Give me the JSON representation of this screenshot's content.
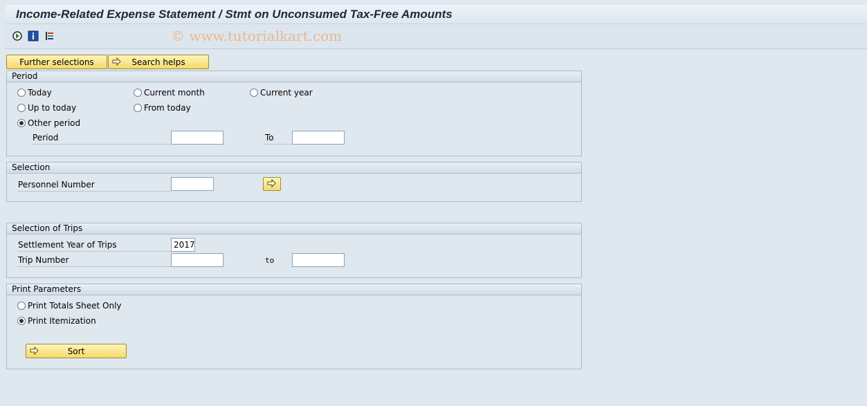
{
  "window": {
    "title": "Income-Related Expense Statement / Stmt on Unconsumed Tax-Free Amounts"
  },
  "toolbar": {
    "icons": [
      "execute-icon",
      "info-icon",
      "variants-icon"
    ],
    "watermark": "© www.tutorialkart.com"
  },
  "buttons": {
    "further_selections": "Further selections",
    "search_helps": "Search helps",
    "sort": "Sort"
  },
  "period": {
    "header": "Period",
    "options": {
      "today": "Today",
      "current_month": "Current month",
      "current_year": "Current year",
      "up_to_today": "Up to today",
      "from_today": "From today",
      "other_period": "Other period"
    },
    "selected": "other_period",
    "period_label": "Period",
    "to_label": "To",
    "from_value": "",
    "to_value": ""
  },
  "selection": {
    "header": "Selection",
    "personnel_number_label": "Personnel Number",
    "personnel_number_value": ""
  },
  "trips": {
    "header": "Selection of Trips",
    "settlement_year_label": "Settlement Year of Trips",
    "settlement_year_value": "2017",
    "trip_number_label": "Trip Number",
    "to_label": "to",
    "trip_from_value": "",
    "trip_to_value": ""
  },
  "print": {
    "header": "Print Parameters",
    "options": {
      "totals_only": "Print Totals Sheet Only",
      "itemization": "Print Itemization"
    },
    "selected": "itemization"
  },
  "colors": {
    "background": "#dfe7ef",
    "button_yellow": "#f5d96a",
    "group_border": "#a9bccd"
  }
}
